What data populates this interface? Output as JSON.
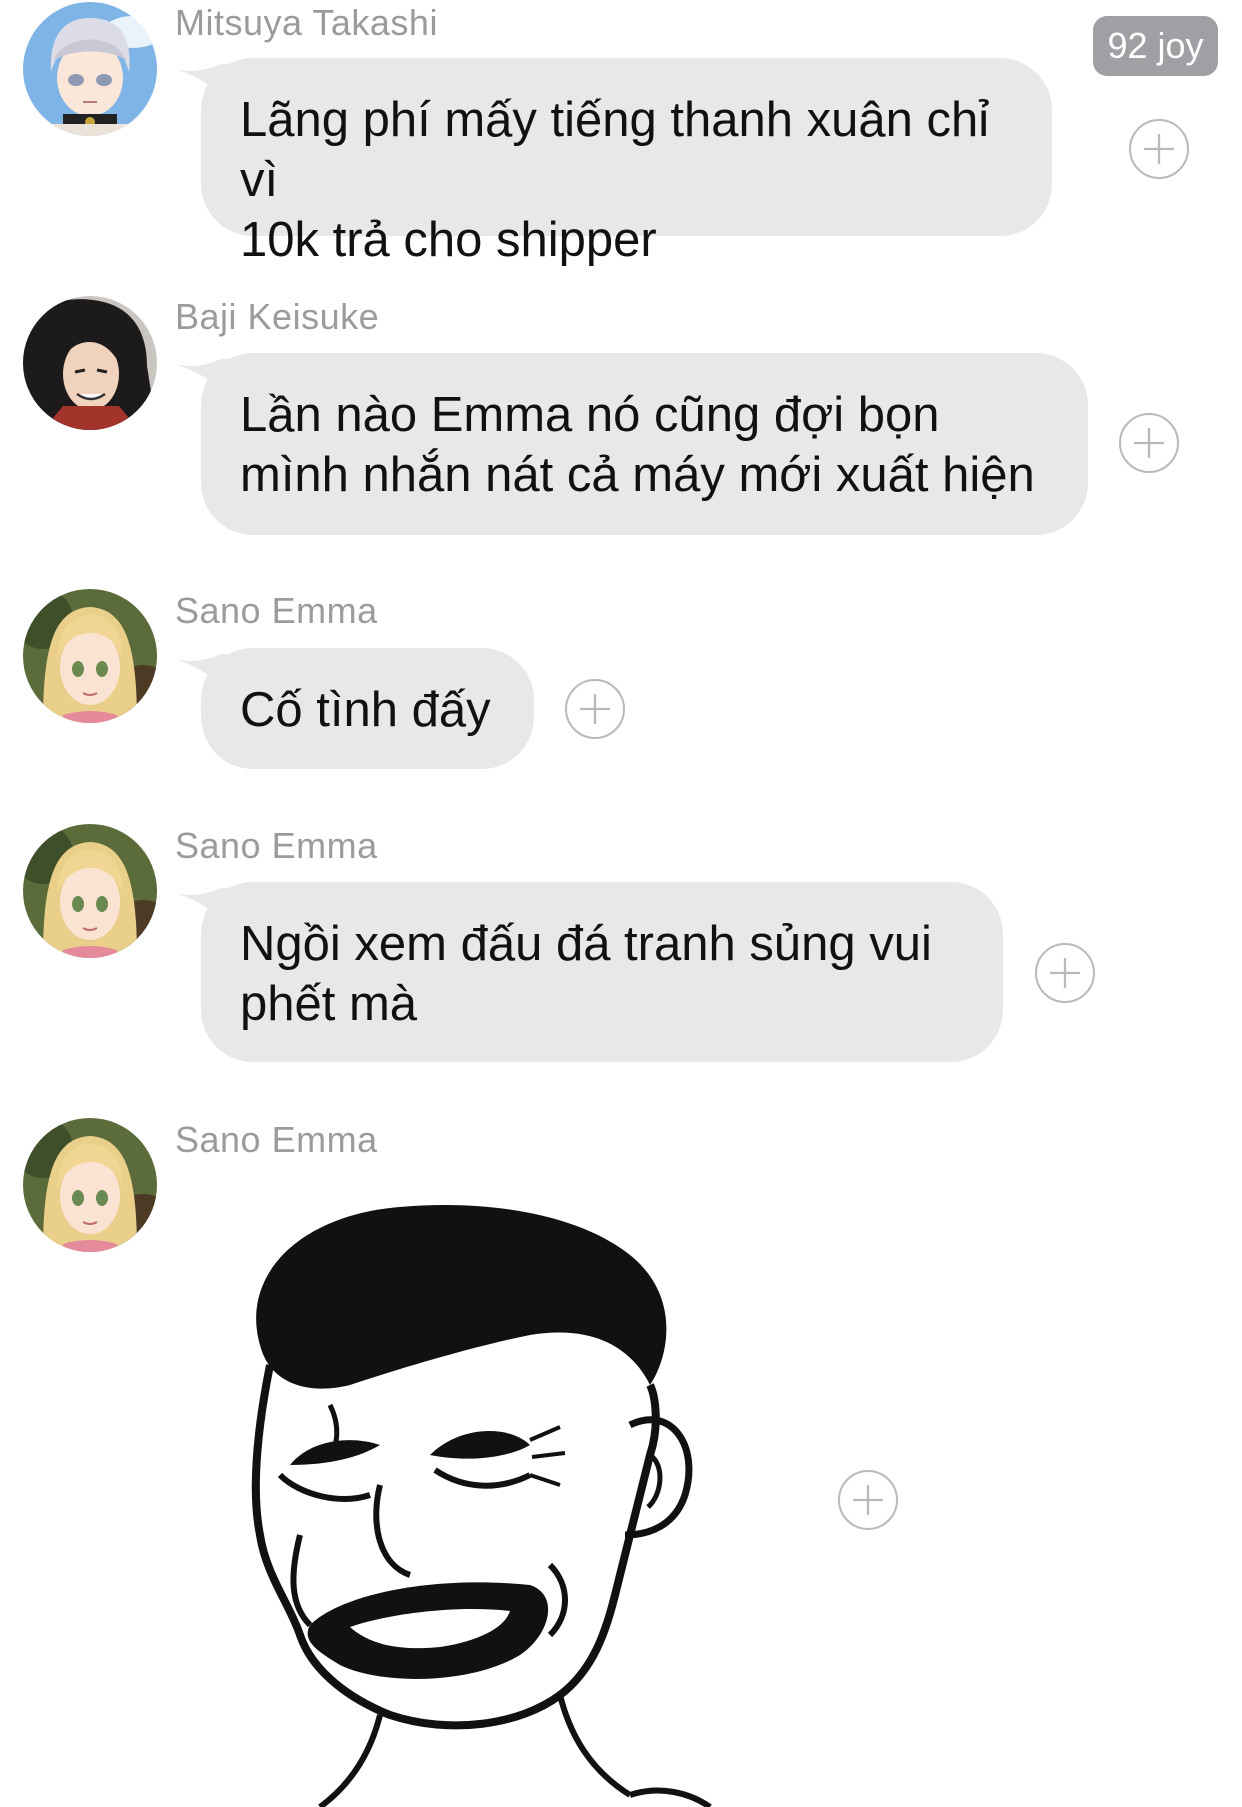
{
  "messages": [
    {
      "sender": "Mitsuya Takashi",
      "text": "Lãng phí mấy tiếng thanh xuân chỉ vì\n10k trả cho shipper",
      "avatar": "avatar-mitsuya",
      "reaction_badge": "92 joy"
    },
    {
      "sender": "Baji Keisuke",
      "text": "Lần nào Emma nó cũng đợi bọn\nmình nhắn nát cả máy mới xuất hiện",
      "avatar": "avatar-baji"
    },
    {
      "sender": "Sano Emma",
      "text": "Cố tình đấy",
      "avatar": "avatar-emma"
    },
    {
      "sender": "Sano Emma",
      "text": "Ngồi xem đấu đá tranh sủng vui\nphết mà",
      "avatar": "avatar-emma"
    },
    {
      "sender": "Sano Emma",
      "sticker": "yao-ming-laughing-face",
      "avatar": "avatar-emma"
    }
  ],
  "colors": {
    "bubble": "#e8e8ea",
    "sender_name": "#9b9b9b",
    "badge_bg": "#9fa0a4",
    "add_reaction": "#b9b9bd"
  },
  "icons": {
    "add_reaction": "plus-circle-icon"
  }
}
